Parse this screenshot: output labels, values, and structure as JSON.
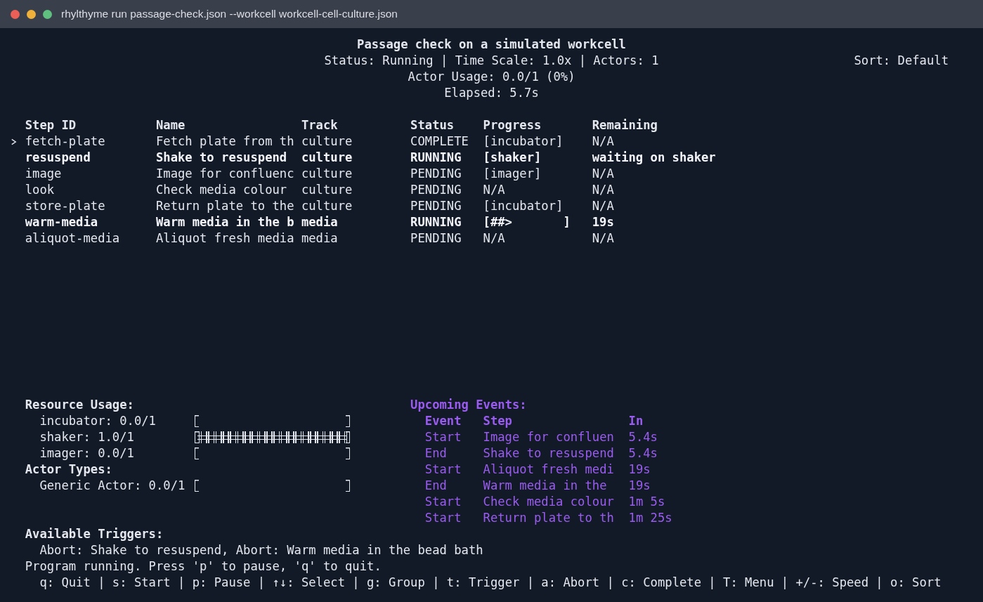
{
  "window": {
    "title": "rhylthyme run passage-check.json --workcell workcell-cell-culture.json"
  },
  "header": {
    "title": "Passage check on a simulated workcell",
    "status_line": "Status: Running | Time Scale: 1.0x | Actors: 1",
    "sort": "Sort: Default",
    "actor_usage": "Actor Usage: 0.0/1 (0%)",
    "elapsed": "Elapsed: 5.7s"
  },
  "steps": {
    "columns": [
      "Step ID",
      "Name",
      "Track",
      "Status",
      "Progress",
      "Remaining"
    ],
    "rows": [
      {
        "selected": true,
        "highlighted": false,
        "cells": [
          "fetch-plate",
          "Fetch plate from th",
          "culture",
          "COMPLETE",
          "[incubator]",
          "N/A"
        ]
      },
      {
        "selected": false,
        "highlighted": true,
        "cells": [
          "resuspend",
          "Shake to resuspend",
          "culture",
          "RUNNING",
          "[shaker]",
          "waiting on shaker"
        ]
      },
      {
        "selected": false,
        "highlighted": false,
        "cells": [
          "image",
          "Image for confluenc",
          "culture",
          "PENDING",
          "[imager]",
          "N/A"
        ]
      },
      {
        "selected": false,
        "highlighted": false,
        "cells": [
          "look",
          "Check media colour",
          "culture",
          "PENDING",
          "N/A",
          "N/A"
        ]
      },
      {
        "selected": false,
        "highlighted": false,
        "cells": [
          "store-plate",
          "Return plate to the",
          "culture",
          "PENDING",
          "[incubator]",
          "N/A"
        ]
      },
      {
        "selected": false,
        "highlighted": true,
        "cells": [
          "warm-media",
          "Warm media in the b",
          "media",
          "RUNNING",
          "[##>       ]",
          "19s"
        ]
      },
      {
        "selected": false,
        "highlighted": false,
        "cells": [
          "aliquot-media",
          "Aliquot fresh media",
          "media",
          "PENDING",
          "N/A",
          "N/A"
        ]
      }
    ]
  },
  "resources": {
    "title": "Resource Usage:",
    "items": [
      {
        "label": "incubator: 0.0/1",
        "level": 0
      },
      {
        "label": "shaker: 1.0/1",
        "level": 1
      },
      {
        "label": "imager: 0.0/1",
        "level": 0
      }
    ]
  },
  "actor_types": {
    "title": "Actor Types:",
    "items": [
      {
        "label": "Generic Actor: 0.0/1",
        "level": 0
      }
    ]
  },
  "events": {
    "title": "Upcoming Events:",
    "columns": [
      "Event",
      "Step",
      "In"
    ],
    "rows": [
      [
        "Start",
        "Image for confluen",
        "5.4s"
      ],
      [
        "End",
        "Shake to resuspend",
        "5.4s"
      ],
      [
        "Start",
        "Aliquot fresh medi",
        "19s"
      ],
      [
        "End",
        "Warm media in the",
        "19s"
      ],
      [
        "Start",
        "Check media colour",
        "1m 5s"
      ],
      [
        "Start",
        "Return plate to th",
        "1m 25s"
      ]
    ]
  },
  "triggers": {
    "title": "Available Triggers:",
    "text": "Abort: Shake to resuspend, Abort: Warm media in the bead bath"
  },
  "status_bar": {
    "message": "Program running. Press 'p' to pause, 'q' to quit.",
    "keys": "q: Quit | s: Start | p: Pause | ↑↓: Select | g: Group | t: Trigger | a: Abort | c: Complete | T: Menu | +/-: Speed | o: Sort"
  }
}
